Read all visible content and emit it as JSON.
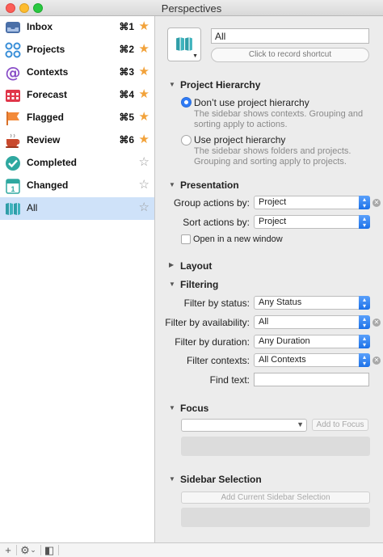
{
  "window": {
    "title": "Perspectives"
  },
  "sidebar": {
    "items": [
      {
        "label": "Inbox",
        "shortcut": "⌘1",
        "starred": true,
        "icon": "inbox-icon",
        "star": "★"
      },
      {
        "label": "Projects",
        "shortcut": "⌘2",
        "starred": true,
        "icon": "projects-icon",
        "star": "★"
      },
      {
        "label": "Contexts",
        "shortcut": "⌘3",
        "starred": true,
        "icon": "contexts-icon",
        "star": "★"
      },
      {
        "label": "Forecast",
        "shortcut": "⌘4",
        "starred": true,
        "icon": "forecast-icon",
        "star": "★"
      },
      {
        "label": "Flagged",
        "shortcut": "⌘5",
        "starred": true,
        "icon": "flag-icon",
        "star": "★"
      },
      {
        "label": "Review",
        "shortcut": "⌘6",
        "starred": true,
        "icon": "review-icon",
        "star": "★"
      },
      {
        "label": "Completed",
        "shortcut": "",
        "starred": false,
        "icon": "completed-icon",
        "star": "☆"
      },
      {
        "label": "Changed",
        "shortcut": "",
        "starred": false,
        "icon": "changed-icon",
        "star": "☆"
      },
      {
        "label": "All",
        "shortcut": "",
        "starred": false,
        "icon": "all-perspective-icon",
        "selected": true,
        "star": "☆"
      }
    ],
    "colors": {
      "selected": "#cfe2f9",
      "star": "#f2a23a"
    }
  },
  "bottombar": {
    "add": "+",
    "gear": "⚙",
    "gear_caret": "⌄",
    "sidebar_toggle": "◧"
  },
  "editor": {
    "name_value": "All",
    "record_shortcut": "Click to record shortcut",
    "project_hierarchy": {
      "title": "Project Hierarchy",
      "options": [
        {
          "label": "Don’t use project hierarchy",
          "desc": "The sidebar shows contexts. Grouping and sorting apply to actions.",
          "selected": true
        },
        {
          "label": "Use project hierarchy",
          "desc": "The sidebar shows folders and projects. Grouping and sorting apply to projects.",
          "selected": false
        }
      ]
    },
    "presentation": {
      "title": "Presentation",
      "group_label": "Group actions by:",
      "group_value": "Project",
      "sort_label": "Sort actions by:",
      "sort_value": "Project",
      "new_window_label": "Open in a new window"
    },
    "layout": {
      "title": "Layout"
    },
    "filtering": {
      "title": "Filtering",
      "status_label": "Filter by status:",
      "status_value": "Any Status",
      "availability_label": "Filter by availability:",
      "availability_value": "All",
      "duration_label": "Filter by duration:",
      "duration_value": "Any Duration",
      "contexts_label": "Filter contexts:",
      "contexts_value": "All Contexts",
      "find_label": "Find text:",
      "find_value": ""
    },
    "focus": {
      "title": "Focus",
      "add_button": "Add to Focus"
    },
    "sidebar_selection": {
      "title": "Sidebar Selection",
      "add_button": "Add Current Sidebar Selection"
    }
  }
}
